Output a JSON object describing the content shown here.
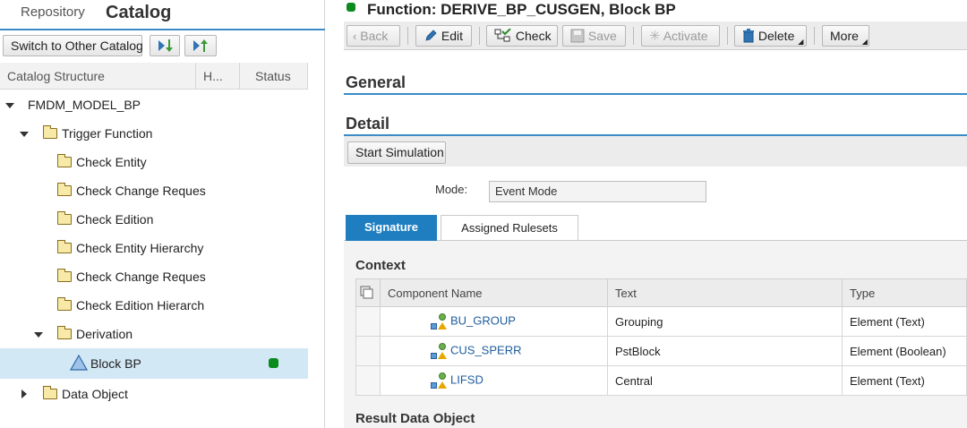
{
  "nav": {
    "repository": "Repository",
    "catalog": "Catalog"
  },
  "left_toolbar": {
    "switch_catalog": "Switch to Other Catalog"
  },
  "columns": {
    "structure": "Catalog Structure",
    "h": "H...",
    "status": "Status"
  },
  "tree": {
    "root": "FMDM_MODEL_BP",
    "trigger_function": "Trigger Function",
    "check_entity": "Check Entity",
    "check_change_request_1": "Check Change Reques",
    "check_edition": "Check Edition",
    "check_entity_hierarchy": "Check Entity Hierarchy",
    "check_change_request_2": "Check Change Reques",
    "check_edition_hierarchy": "Check Edition Hierarch",
    "derivation": "Derivation",
    "block_bp": "Block BP",
    "data_object": "Data Object",
    "status_color": "#0b8a1e"
  },
  "header": {
    "title": "Function: DERIVE_BP_CUSGEN, Block BP"
  },
  "toolbar": {
    "back": "Back",
    "edit": "Edit",
    "check": "Check",
    "save": "Save",
    "activate": "Activate",
    "delete": "Delete",
    "more": "More"
  },
  "sections": {
    "general": "General",
    "detail": "Detail"
  },
  "detail": {
    "start_simulation": "Start Simulation",
    "mode_label": "Mode:",
    "mode_value": "Event Mode"
  },
  "tabs": {
    "signature": "Signature",
    "assigned_rulesets": "Assigned Rulesets"
  },
  "context": {
    "title": "Context",
    "headers": {
      "component": "Component Name",
      "text": "Text",
      "type": "Type"
    },
    "rows": [
      {
        "component": "BU_GROUP",
        "text": "Grouping",
        "type": "Element (Text)"
      },
      {
        "component": "CUS_SPERR",
        "text": "PstBlock",
        "type": "Element (Boolean)"
      },
      {
        "component": "LIFSD",
        "text": "Central",
        "type": "Element (Text)"
      }
    ]
  },
  "result_title": "Result Data Object",
  "colors": {
    "accent": "#3a8bc8",
    "selected_tab": "#1e7ec0",
    "selection": "#d3e8f5"
  }
}
